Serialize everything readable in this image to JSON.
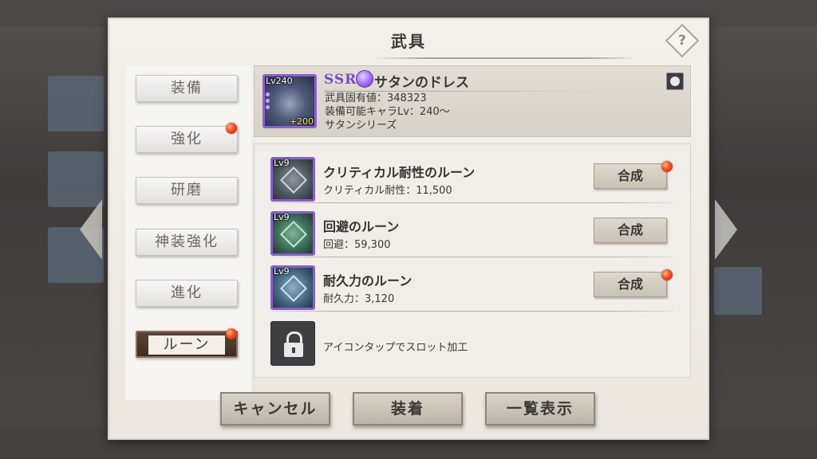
{
  "dialog": {
    "title": "武具",
    "help_symbol": "?"
  },
  "tabs": [
    {
      "label": "装備",
      "badge": false
    },
    {
      "label": "強化",
      "badge": true
    },
    {
      "label": "研磨",
      "badge": false
    },
    {
      "label": "神装強化",
      "badge": false
    },
    {
      "label": "進化",
      "badge": false
    },
    {
      "label": "ルーン",
      "badge": true,
      "active": true
    }
  ],
  "weapon": {
    "level": "Lv240",
    "plus": "+200",
    "rarity": "SSR",
    "name": "サタンのドレス",
    "unique_value": "武具固有値：348323",
    "equip_level": "装備可能キャラLv：240～",
    "series": "サタンシリーズ"
  },
  "runes": [
    {
      "level": "Lv9",
      "name": "クリティカル耐性のルーン",
      "stat": "クリティカル耐性：11,500",
      "button": "合成",
      "badge": true,
      "color": "gray"
    },
    {
      "level": "Lv9",
      "name": "回避のルーン",
      "stat": "回避：59,300",
      "button": "合成",
      "badge": false,
      "color": "green"
    },
    {
      "level": "Lv9",
      "name": "耐久力のルーン",
      "stat": "耐久力：3,120",
      "button": "合成",
      "badge": true,
      "color": "blue"
    }
  ],
  "locked_slot": {
    "text": "アイコンタップでスロット加工"
  },
  "buttons": {
    "cancel": "キャンセル",
    "equip": "装着",
    "list": "一覧表示"
  }
}
